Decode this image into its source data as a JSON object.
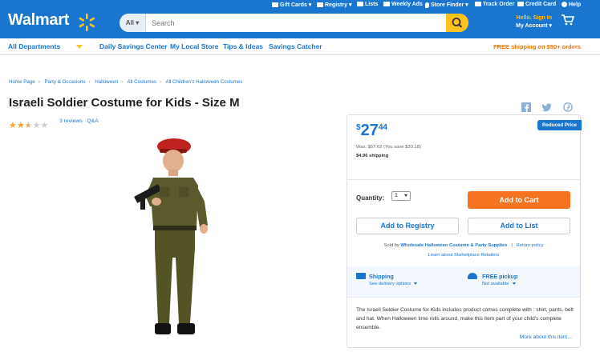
{
  "header": {
    "logo": "Walmart",
    "search": {
      "scope": "All",
      "placeholder": "Search"
    },
    "utility_links": [
      "Gift Cards",
      "Registry",
      "Lists",
      "Weekly Ads",
      "Store Finder",
      "Track Order",
      "Credit Card",
      "Help"
    ],
    "account": {
      "hello": "Hello. Sign In",
      "my_account": "My Account"
    }
  },
  "nav": {
    "all_departments": "All Departments",
    "items": [
      "Daily Savings Center",
      "My Local Store",
      "Tips & Ideas",
      "Savings Catcher"
    ],
    "free_shipping": "FREE shipping on $50+ orders"
  },
  "breadcrumbs": [
    "Home Page",
    "Party & Occasions",
    "Halloween",
    "All Costumes",
    "All Children's Halloween Costumes"
  ],
  "product": {
    "title": "Israeli Soldier Costume for Kids - Size M",
    "rating": 2.5,
    "reviews_label": "3 reviews",
    "qa_label": "Q&A"
  },
  "offer": {
    "badge": "Reduced Price",
    "currency": "$",
    "price_dollars": "27",
    "price_cents": "44",
    "was": "Was: $57.62  (You save $30.18)",
    "shipping_cost": "$4.96 shipping",
    "quantity_label": "Quantity:",
    "quantity_value": "1",
    "add_to_cart": "Add to Cart",
    "add_to_registry": "Add to Registry",
    "add_to_list": "Add to List",
    "sold_by_prefix": "Sold by",
    "seller": "Wholesale Halloween Costume & Party Supplies",
    "return_policy": "Return policy",
    "learn_marketplace": "Learn about Marketplace Retailers"
  },
  "fulfillment": {
    "shipping_title": "Shipping",
    "shipping_sub": "See delivery options",
    "pickup_title": "FREE pickup",
    "pickup_sub": "Not available"
  },
  "description": {
    "text": "The Israeli Soldier Costume for Kids includes product comes complete with : shirt, pants, belt and hat. When Halloween time rolls around, make this item part of your child's complete ensemble.",
    "more": "More about this item..."
  },
  "colors": {
    "walmart_blue": "#1a75cf",
    "spark_yellow": "#ffc220",
    "cart_orange": "#f47321"
  }
}
